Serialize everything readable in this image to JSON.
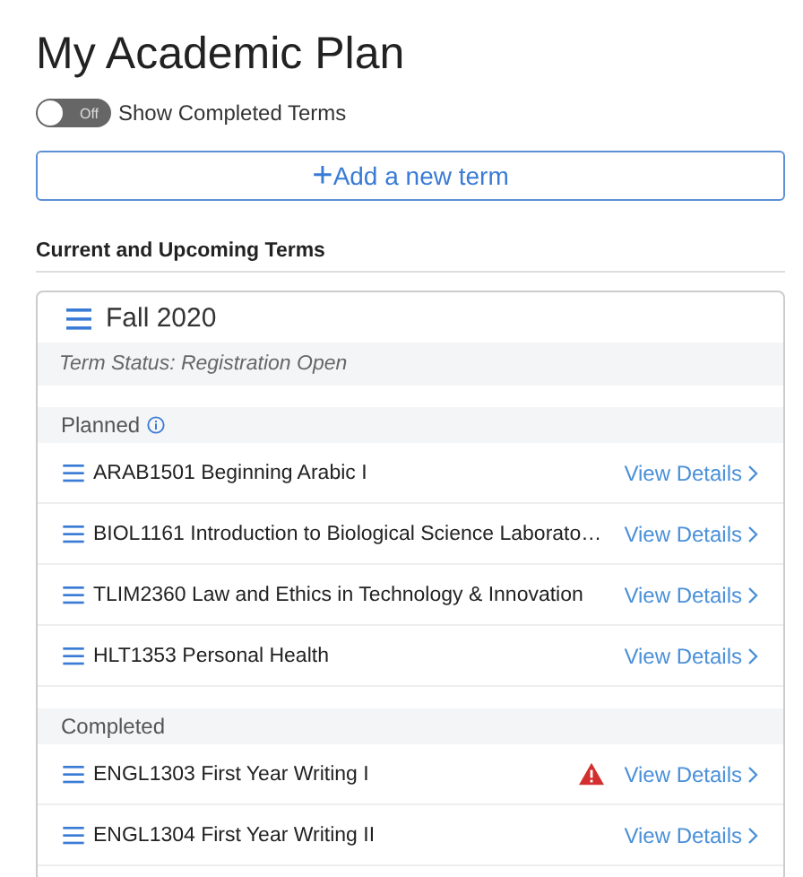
{
  "page_title": "My Academic Plan",
  "completed_toggle": {
    "on": false,
    "state_label": "Off",
    "label": "Show Completed Terms"
  },
  "add_term_button": {
    "icon": "+",
    "label": "Add a new term"
  },
  "section_heading": "Current and Upcoming Terms",
  "term": {
    "title": "Fall 2020",
    "status": "Term Status: Registration Open",
    "groups": [
      {
        "label": "Planned",
        "info": true,
        "courses": [
          {
            "name": "ARAB1501 Beginning Arabic I",
            "warning": false,
            "link": "View Details"
          },
          {
            "name": "BIOL1161 Introduction to Biological Science Laborato…",
            "warning": false,
            "link": "View Details"
          },
          {
            "name": "TLIM2360 Law and Ethics in Technology & Innovation",
            "warning": false,
            "link": "View Details"
          },
          {
            "name": "HLT1353 Personal Health",
            "warning": false,
            "link": "View Details"
          }
        ]
      },
      {
        "label": "Completed",
        "info": false,
        "courses": [
          {
            "name": "ENGL1303 First Year Writing I",
            "warning": true,
            "link": "View Details"
          },
          {
            "name": "ENGL1304 First Year Writing II",
            "warning": false,
            "link": "View Details"
          }
        ]
      }
    ]
  }
}
